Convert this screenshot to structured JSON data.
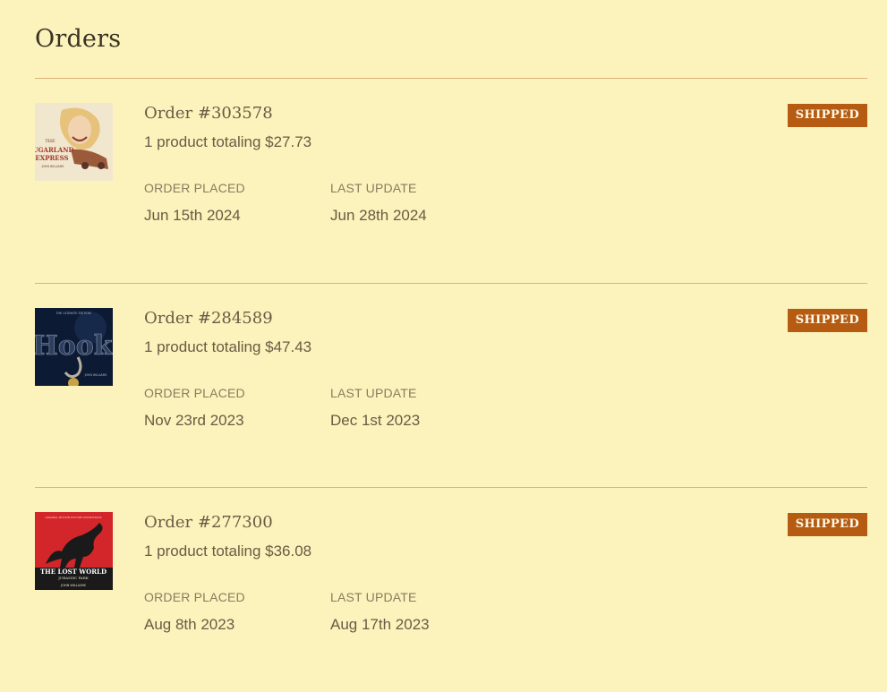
{
  "page": {
    "title": "Orders"
  },
  "orders": [
    {
      "number": "Order #303578",
      "summary": "1 product totaling $27.73",
      "status": "SHIPPED",
      "placed_label": "ORDER PLACED",
      "placed": "Jun 15th 2024",
      "update_label": "LAST UPDATE",
      "updated": "Jun 28th 2024",
      "cover": {
        "icon": "album-cover-sugarland-express",
        "text_top": "THE",
        "text_main": "SUGARLAND",
        "text_sub": "EXPRESS",
        "credit": "JOHN WILLIAMS"
      }
    },
    {
      "number": "Order #284589",
      "summary": "1 product totaling $47.43",
      "status": "SHIPPED",
      "placed_label": "ORDER PLACED",
      "placed": "Nov 23rd 2023",
      "update_label": "LAST UPDATE",
      "updated": "Dec 1st 2023",
      "cover": {
        "icon": "album-cover-hook",
        "text_top": "THE ULTIMATE EDITION",
        "text_main": "Hook",
        "credit": "JOHN WILLIAMS"
      }
    },
    {
      "number": "Order #277300",
      "summary": "1 product totaling $36.08",
      "status": "SHIPPED",
      "placed_label": "ORDER PLACED",
      "placed": "Aug 8th 2023",
      "update_label": "LAST UPDATE",
      "updated": "Aug 17th 2023",
      "cover": {
        "icon": "album-cover-lost-world",
        "text_top": "ORIGINAL MOTION PICTURE SOUNDTRACK",
        "text_main": "THE LOST WORLD",
        "text_sub": "JURASSIC PARK",
        "credit": "JOHN WILLIAMS"
      }
    }
  ],
  "colors": {
    "background": "#fbf3bb",
    "divider": "#dcb27b",
    "badge": "#b65c12",
    "title": "#3d3124",
    "text": "#6b5a45"
  }
}
